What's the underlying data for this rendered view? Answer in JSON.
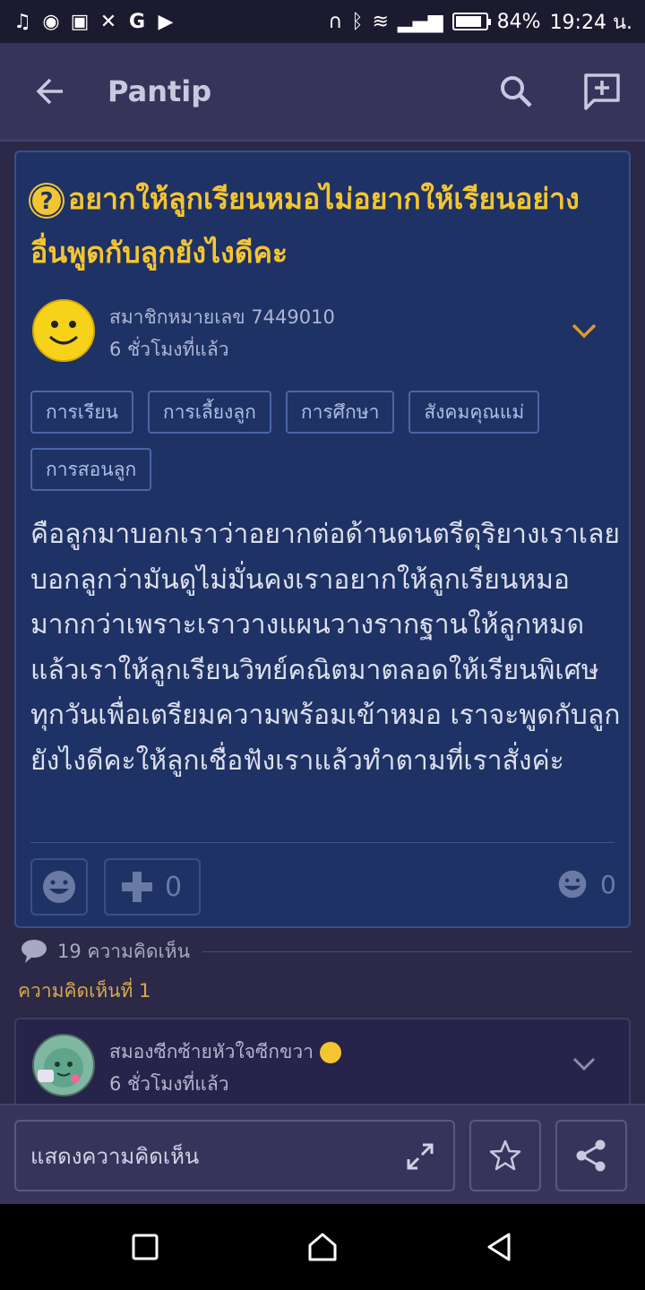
{
  "status_bar": {
    "left_icons": [
      "music-icon",
      "badge-icon",
      "gamepad-icon",
      "x-icon",
      "google-icon",
      "youtube-icon"
    ],
    "battery": "84%",
    "battery_level": 0.84,
    "time": "19:24 น."
  },
  "app_bar": {
    "title": "Pantip"
  },
  "topic": {
    "title": "อยากให้ลูกเรียนหมอไม่อยากให้เรียนอย่างอื่นพูดกับลูกยังไงดีคะ",
    "author": "สมาชิกหมายเลข 7449010",
    "time": "6 ชั่วโมงที่แล้ว",
    "tags": [
      "การเรียน",
      "การเลี้ยงลูก",
      "การศึกษา",
      "สังคมคุณแม่",
      "การสอนลูก"
    ],
    "body": "คือลูกมาบอกเราว่าอยากต่อด้านดนตรีดุริยางเราเลยบอกลูกว่ามันดูไม่มั่นคงเราอยากให้ลูกเรียนหมอมากกว่าเพราะเราวางแผนวางรากฐานให้ลูกหมดแล้วเราให้ลูกเรียนวิทย์คณิตมาตลอดให้เรียนพิเศษทุกวันเพื่อเตรียมความพร้อมเข้าหมอ เราจะพูดกับลูกยังไงดีคะให้ลูกเชื่อฟังเราแล้วทำตามที่เราสั่งค่ะ",
    "plus_count": "0",
    "reaction_count": "0"
  },
  "comments": {
    "count_label": "19 ความคิดเห็น",
    "first_comment_label": "ความคิดเห็นที่ 1",
    "first_comment_author": "สมองซีกซ้ายหัวใจซีกขวา",
    "first_comment_time": "6 ชั่วโมงที่แล้ว"
  },
  "action_bar": {
    "comment_placeholder": "แสดงความคิดเห็น"
  },
  "colors": {
    "title_accent": "#f5c531",
    "card_bg": "#1e3265",
    "app_bg": "#2b2947",
    "comment_label": "#d9a84a"
  }
}
